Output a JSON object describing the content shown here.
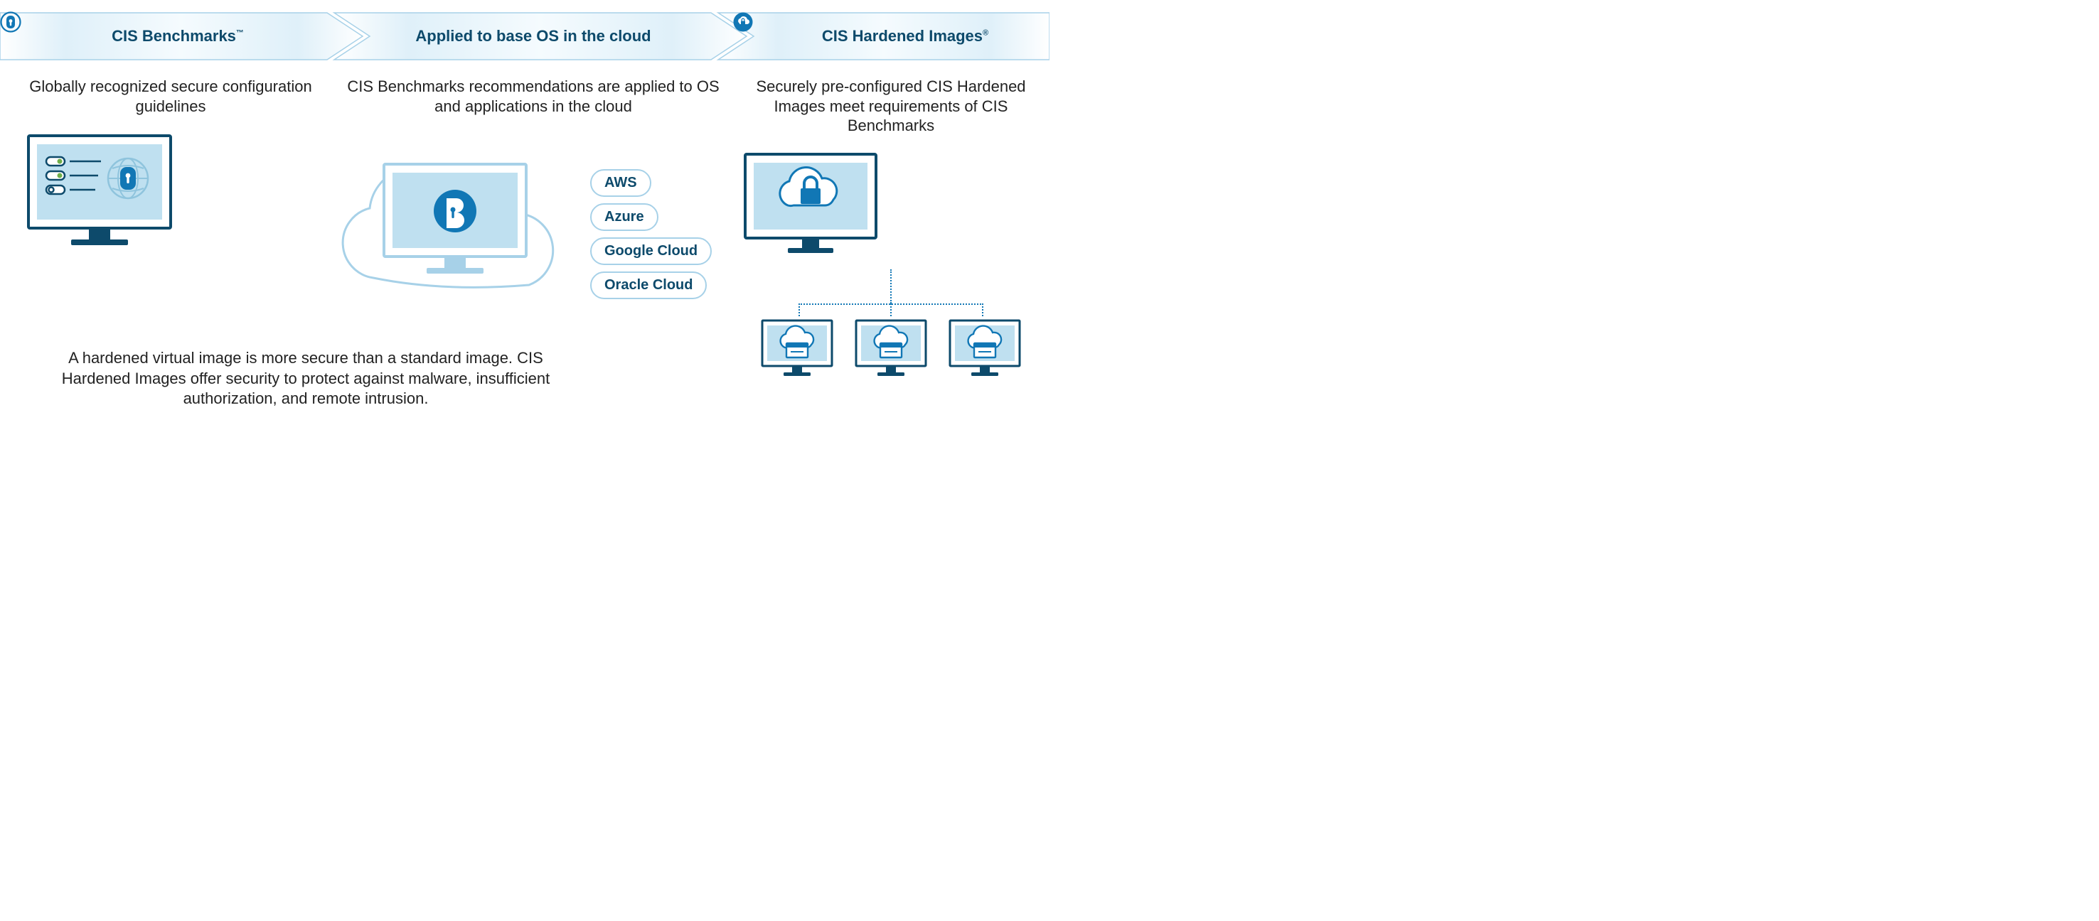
{
  "colors": {
    "brand_dark": "#0d4a6b",
    "brand_blue": "#1177b5",
    "band_fill": "#dff0f9",
    "band_stroke": "#a7d1e8",
    "screen_fill": "#bfe0f0",
    "monitor_stroke": "#0d4a6b"
  },
  "band": {
    "col1_title": "CIS Benchmarks",
    "col1_mark": "™",
    "col2_title": "Applied to base OS in the cloud",
    "col3_title": "CIS Hardened Images",
    "col3_mark": "®"
  },
  "descriptions": {
    "col1": "Globally recognized secure configuration guidelines",
    "col2": "CIS Benchmarks recommendations are applied to OS and applications in the cloud",
    "col3": "Securely pre-configured CIS Hardened Images meet requirements of CIS Benchmarks"
  },
  "providers": [
    "AWS",
    "Azure",
    "Google Cloud",
    "Oracle Cloud"
  ],
  "bottom": "A hardened virtual image is more secure than a standard image. CIS Hardened Images offer security to protect against malware, insufficient authorization, and remote intrusion."
}
